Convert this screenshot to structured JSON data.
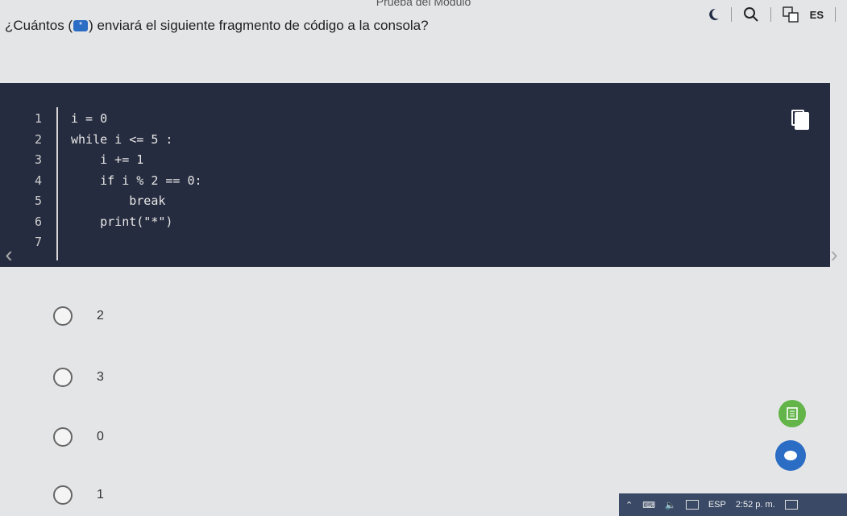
{
  "page": {
    "title": "Prueba del Módulo"
  },
  "header": {
    "question_prefix": "¿Cuántos (",
    "question_suffix": ") enviará el siguiente fragmento de código a la consola?",
    "question_icon_glyph": "*",
    "lang": "ES",
    "icons": [
      "moon-icon",
      "search-icon",
      "translate-icon"
    ]
  },
  "code": {
    "lines": [
      {
        "num": "1",
        "text": "i = 0"
      },
      {
        "num": "2",
        "text": "while i <= 5 :"
      },
      {
        "num": "3",
        "text": "    i += 1"
      },
      {
        "num": "4",
        "text": "    if i % 2 == 0:"
      },
      {
        "num": "5",
        "text": "        break"
      },
      {
        "num": "6",
        "text": "    print(\"*\")"
      },
      {
        "num": "7",
        "text": ""
      }
    ]
  },
  "options": [
    {
      "label": "2"
    },
    {
      "label": "3"
    },
    {
      "label": "0"
    },
    {
      "label": "1"
    }
  ],
  "taskbar": {
    "lang": "ESP",
    "time": "2:52 p. m."
  },
  "colors": {
    "code_bg": "#262c3f",
    "accent_green": "#63b54a",
    "accent_blue": "#2b6cc4",
    "taskbar_bg": "#3a4a66"
  }
}
